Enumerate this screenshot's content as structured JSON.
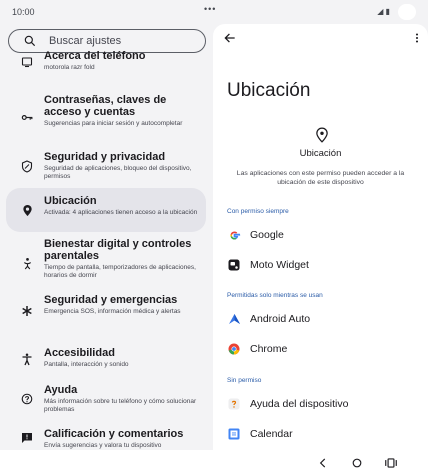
{
  "status": {
    "time": "10:00",
    "dots": "•••",
    "signal": "◢ ▮"
  },
  "search": {
    "placeholder": "Buscar ajustes"
  },
  "settings": [
    {
      "title": "Acerca del teléfono",
      "subtitle": "motorola razr fold"
    },
    {
      "title": "Contraseñas, claves de acceso y cuentas",
      "subtitle": "Sugerencias para iniciar sesión y autocompletar"
    },
    {
      "title": "Seguridad y privacidad",
      "subtitle": "Seguridad de aplicaciones, bloqueo del dispositivo, permisos"
    },
    {
      "title": "Ubicación",
      "subtitle": "Activada: 4 aplicaciones tienen acceso a la ubicación"
    },
    {
      "title": "Bienestar digital y controles parentales",
      "subtitle": "Tiempo de pantalla, temporizadores de aplicaciones, horarios de dormir"
    },
    {
      "title": "Seguridad y emergencias",
      "subtitle": "Emergencia SOS, información médica y alertas"
    },
    {
      "title": "Accesibilidad",
      "subtitle": "Pantalla, interacción y sonido"
    },
    {
      "title": "Ayuda",
      "subtitle": "Más información sobre tu teléfono y cómo solucionar problemas"
    },
    {
      "title": "Calificación y comentarios",
      "subtitle": "Envía sugerencias y valora tu dispositivo"
    }
  ],
  "detail": {
    "title": "Ubicación",
    "hero_title": "Ubicación",
    "hero_desc": "Las aplicaciones con este permiso pueden acceder a la ubicación de este dispositivo",
    "sections": [
      {
        "label": "Con permiso siempre",
        "apps": [
          "Google",
          "Moto Widget"
        ]
      },
      {
        "label": "Permitidas solo mientras se usan",
        "apps": [
          "Android Auto",
          "Chrome"
        ]
      },
      {
        "label": "Sin permiso",
        "apps": [
          "Ayuda del dispositivo",
          "Calendar"
        ]
      }
    ]
  },
  "colors": {
    "accent": "#2b5ca8",
    "selected_bg": "#e4e4ea",
    "panel_bg": "#f3f3f5"
  }
}
